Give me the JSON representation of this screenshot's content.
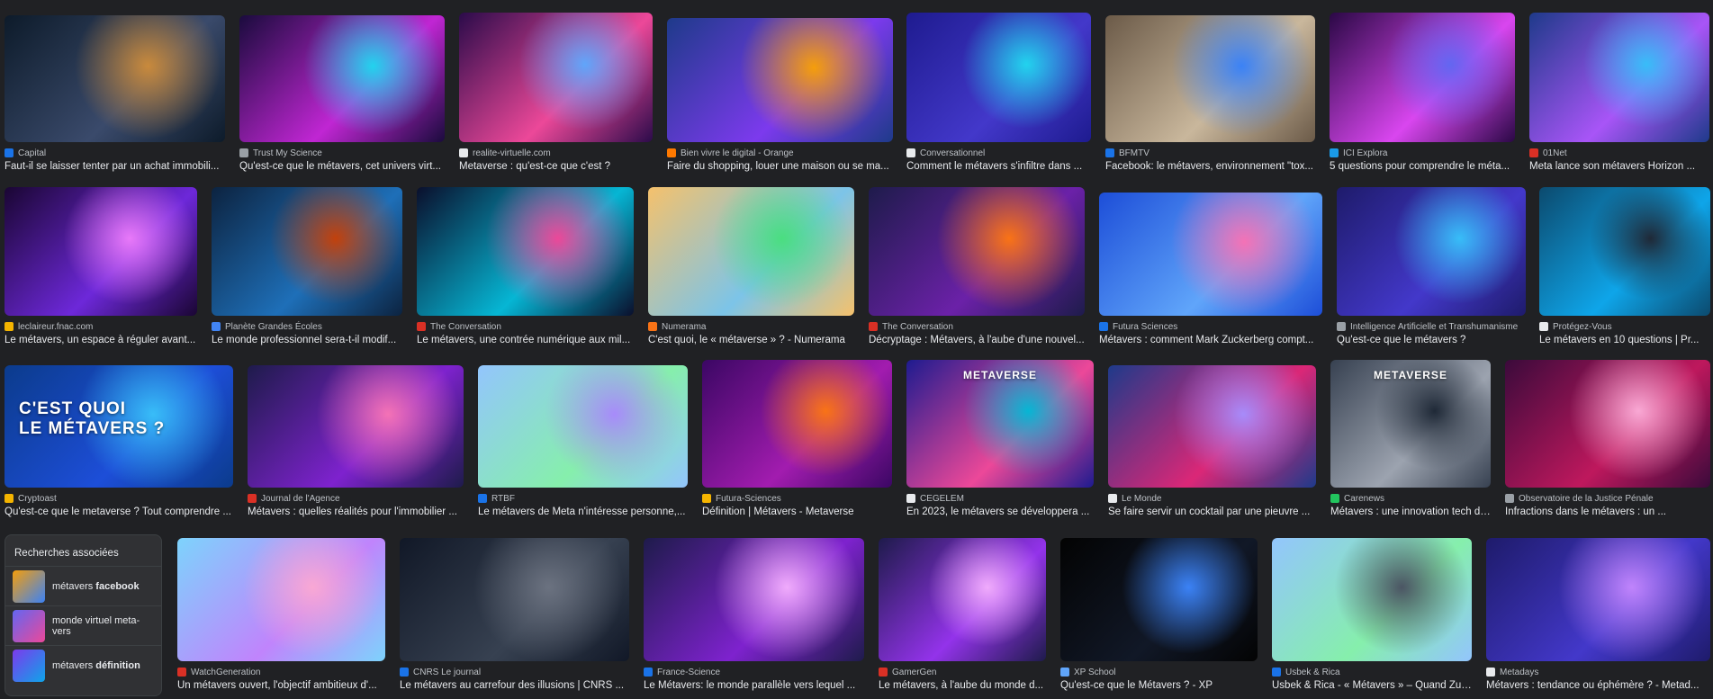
{
  "results": [
    {
      "source": "Capital",
      "title": "Faut-il se laisser tenter par un achat immobili...",
      "colors": [
        "#0d1b2a",
        "#3a4a6b",
        "#c98a3c"
      ],
      "fav": "#1a73e8"
    },
    {
      "source": "Trust My Science",
      "title": "Qu'est-ce que le métavers, cet univers virt...",
      "colors": [
        "#1a0b3d",
        "#c026d3",
        "#22d3ee"
      ],
      "fav": "#9aa0a6"
    },
    {
      "source": "realite-virtuelle.com",
      "title": "Metaverse : qu'est-ce que c'est ?",
      "colors": [
        "#2b0b4a",
        "#ec4899",
        "#60a5fa"
      ],
      "fav": "#e8eaed"
    },
    {
      "source": "Bien vivre le digital - Orange",
      "title": "Faire du shopping, louer une maison ou se ma...",
      "colors": [
        "#1e3a8a",
        "#7c3aed",
        "#f59e0b"
      ],
      "fav": "#ff7900"
    },
    {
      "source": "Conversationnel",
      "title": "Comment le métavers s'infiltre dans ...",
      "colors": [
        "#1e1b8f",
        "#4338ca",
        "#22d3ee"
      ],
      "fav": "#e8eaed"
    },
    {
      "source": "BFMTV",
      "title": "Facebook: le métavers, environnement \"tox...",
      "colors": [
        "#6b5a48",
        "#c9b79c",
        "#3b82f6"
      ],
      "fav": "#1a73e8"
    },
    {
      "source": "ICI Explora",
      "title": "5 questions pour comprendre le méta...",
      "colors": [
        "#2a0845",
        "#d946ef",
        "#6366f1"
      ],
      "fav": "#1a9be8"
    },
    {
      "source": "01Net",
      "title": "Meta lance son métavers Horizon ...",
      "colors": [
        "#1e3a8a",
        "#a855f7",
        "#38bdf8"
      ],
      "fav": "#d93025"
    },
    {
      "source": "leclaireur.fnac.com",
      "title": "Le métavers, un espace à réguler avant...",
      "colors": [
        "#1a0633",
        "#6d28d9",
        "#e879f9"
      ],
      "fav": "#f4b400"
    },
    {
      "source": "Planète Grandes Écoles",
      "title": "Le monde professionnel sera-t-il modif...",
      "colors": [
        "#0c2340",
        "#1e6fb8",
        "#c2410c"
      ],
      "fav": "#4285f4"
    },
    {
      "source": "The Conversation",
      "title": "Le métavers, une contrée numérique aux mil...",
      "colors": [
        "#0a0f2c",
        "#06b6d4",
        "#ec4899"
      ],
      "fav": "#d93025"
    },
    {
      "source": "Numerama",
      "title": "C'est quoi, le « métaverse » ? - Numerama",
      "colors": [
        "#f5c16c",
        "#7cc4e8",
        "#4ade80"
      ],
      "fav": "#f97316"
    },
    {
      "source": "The Conversation",
      "title": "Décryptage : Métavers, à l'aube d'une nouvel...",
      "colors": [
        "#1e1b4b",
        "#6b21a8",
        "#f97316"
      ],
      "fav": "#d93025"
    },
    {
      "source": "Futura Sciences",
      "title": "Métavers : comment Mark Zuckerberg compt...",
      "colors": [
        "#1d4ed8",
        "#60a5fa",
        "#f472b6"
      ],
      "fav": "#1a73e8"
    },
    {
      "source": "Intelligence Artificielle et Transhumanisme",
      "title": "Qu'est-ce que le métavers ?",
      "colors": [
        "#1e1b6b",
        "#4338ca",
        "#38bdf8"
      ],
      "fav": "#9aa0a6"
    },
    {
      "source": "Protégez-Vous",
      "title": "Le métavers en 10 questions | Pr...",
      "colors": [
        "#0c4a6e",
        "#0ea5e9",
        "#1f2937"
      ],
      "fav": "#e8eaed"
    },
    {
      "source": "Cryptoast",
      "title": "Qu'est-ce que le metaverse ? Tout comprendre ...",
      "colors": [
        "#0b3b8c",
        "#1d4ed8",
        "#38bdf8"
      ],
      "fav": "#f4b400",
      "overlay": "C'EST QUOI\nLE MÉTAVERS ?"
    },
    {
      "source": "Journal de l'Agence",
      "title": "Métavers : quelles réalités pour l'immobilier ...",
      "colors": [
        "#1e1b4b",
        "#7e22ce",
        "#f472b6"
      ],
      "fav": "#d93025"
    },
    {
      "source": "RTBF",
      "title": "Le métavers de Meta n'intéresse personne,...",
      "colors": [
        "#93c5fd",
        "#86efac",
        "#a78bfa"
      ],
      "fav": "#1a73e8"
    },
    {
      "source": "Futura-Sciences",
      "title": "Définition | Métavers - Metaverse",
      "colors": [
        "#3b0764",
        "#a21caf",
        "#f97316"
      ],
      "fav": "#f4b400"
    },
    {
      "source": "CEGELEM",
      "title": "En 2023, le métavers se développera ...",
      "colors": [
        "#1e1b8f",
        "#ec4899",
        "#06b6d4"
      ],
      "fav": "#e8eaed",
      "overlay": "METAVERSE"
    },
    {
      "source": "Le Monde",
      "title": "Se faire servir un cocktail par une pieuvre ...",
      "colors": [
        "#1e3a8a",
        "#db2777",
        "#a78bfa"
      ],
      "fav": "#e8eaed"
    },
    {
      "source": "Carenews",
      "title": "Métavers : une innovation tech dont la...",
      "colors": [
        "#374151",
        "#9ca3af",
        "#1f2937"
      ],
      "fav": "#22c55e",
      "overlay": "METAVERSE"
    },
    {
      "source": "Observatoire de la Justice Pénale",
      "title": "Infractions dans le métavers : un ...",
      "colors": [
        "#3b0a3b",
        "#be185d",
        "#f9a8d4"
      ],
      "fav": "#9aa0a6"
    },
    {
      "source": "WatchGeneration",
      "title": "Un métavers ouvert, l'objectif ambitieux d'...",
      "colors": [
        "#7dd3fc",
        "#c084fc",
        "#f9a8d4"
      ],
      "fav": "#d93025"
    },
    {
      "source": "CNRS Le journal",
      "title": "Le métavers au carrefour des illusions | CNRS ...",
      "colors": [
        "#111827",
        "#374151",
        "#6b7280"
      ],
      "fav": "#1a73e8"
    },
    {
      "source": "France-Science",
      "title": "Le Métavers: le monde parallèle vers lequel ...",
      "colors": [
        "#1e1b4b",
        "#7e22ce",
        "#f0abfc"
      ],
      "fav": "#1a73e8"
    },
    {
      "source": "GamerGen",
      "title": "Le métavers, à l'aube du monde d...",
      "colors": [
        "#1e1b4b",
        "#9333ea",
        "#f0abfc"
      ],
      "fav": "#d93025"
    },
    {
      "source": "XP School",
      "title": "Qu'est-ce que le Métavers ? - XP",
      "colors": [
        "#030303",
        "#111827",
        "#3b82f6"
      ],
      "fav": "#60a5fa"
    },
    {
      "source": "Usbek & Rica",
      "title": "Usbek & Rica - « Métavers » – Quand Zuc...",
      "colors": [
        "#93c5fd",
        "#86efac",
        "#4b5563"
      ],
      "fav": "#1a73e8"
    },
    {
      "source": "Metadays",
      "title": "Métavers : tendance ou éphémère ? - Metad...",
      "colors": [
        "#1e1b6b",
        "#4338ca",
        "#c084fc"
      ],
      "fav": "#e8eaed"
    }
  ],
  "related": {
    "heading": "Recherches associées",
    "items": [
      {
        "prefix": "métavers ",
        "bold": "facebook",
        "colors": [
          "#f59e0b",
          "#3b82f6"
        ]
      },
      {
        "prefix": "monde virtuel meta-\nvers",
        "bold": "",
        "colors": [
          "#6366f1",
          "#ec4899"
        ]
      },
      {
        "prefix": "métavers ",
        "bold": "définition",
        "colors": [
          "#7c3aed",
          "#0ea5e9"
        ]
      }
    ]
  }
}
